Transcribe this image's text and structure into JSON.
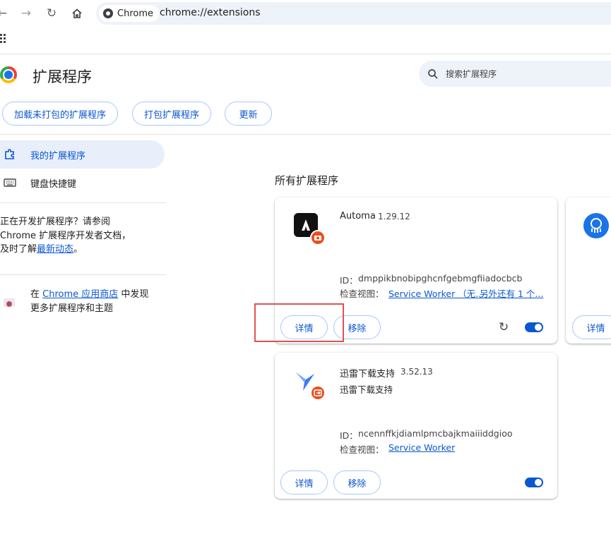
{
  "browser": {
    "site_chip": "Chrome",
    "url": "chrome://extensions"
  },
  "header": {
    "title": "扩展程序",
    "search_placeholder": "搜索扩展程序"
  },
  "toolbar": {
    "load_unpacked": "加载未打包的扩展程序",
    "pack": "打包扩展程序",
    "update": "更新"
  },
  "sidebar": {
    "items": [
      {
        "label": "我的扩展程序",
        "active": true
      },
      {
        "label": "键盘快捷键",
        "active": false
      }
    ],
    "dev_text_1": "正在开发扩展程序？请参阅",
    "dev_text_2": "Chrome 扩展程序开发者文档，",
    "dev_text_3": "及时了解",
    "dev_link": "最新动态",
    "dev_text_end": "。",
    "store_prefix": "在 ",
    "store_link": "Chrome 应用商店",
    "store_suffix": " 中发现更多扩展程序和主题"
  },
  "main": {
    "section_title": "所有扩展程序",
    "extensions": [
      {
        "name": "Automa",
        "version": "1.29.12",
        "description": "",
        "id_label": "ID：",
        "id": "dmppikbnobipghcnfgebmgfiiadocbcb",
        "inspect_label": "检查视图：",
        "inspect_link_1": "Service Worker （无...",
        "inspect_link_2": "另外还有 1 个...",
        "details": "详情",
        "remove": "移除",
        "enabled": true
      },
      {
        "name": "迅雷下载支持",
        "version": "3.52.13",
        "description": "迅雷下载支持",
        "id_label": "ID：",
        "id": "ncennffkjdiamlpmcbajkmaiiiddgioo",
        "inspect_label": "检查视图：",
        "inspect_link_1": "Service Worker",
        "details": "详情",
        "remove": "移除",
        "enabled": true
      },
      {
        "details": "详情"
      }
    ]
  },
  "colors": {
    "accent": "#0b57d0",
    "highlight": "#e35050"
  }
}
